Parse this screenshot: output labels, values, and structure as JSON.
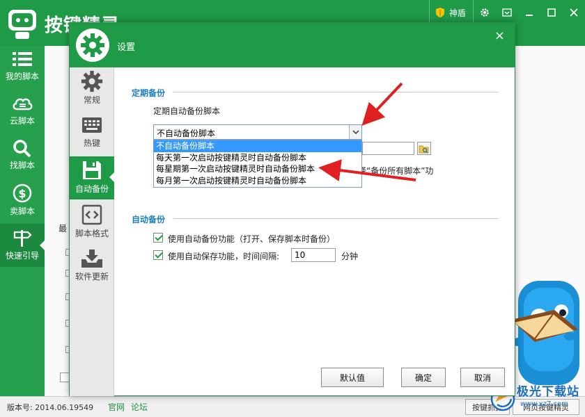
{
  "app": {
    "title": "按键精灵",
    "shield_label": "神盾",
    "sidebar": [
      {
        "label": "我的脚本",
        "icon": "list-icon"
      },
      {
        "label": "云脚本",
        "icon": "cloud-icon"
      },
      {
        "label": "找脚本",
        "icon": "search-icon"
      },
      {
        "label": "卖脚本",
        "icon": "dollar-icon"
      },
      {
        "label": "快速引导",
        "icon": "signpost-icon"
      }
    ],
    "partial_label": "最"
  },
  "status": {
    "version": "版本号: 2014.06.19549",
    "official": "官网",
    "forum": "论坛",
    "btn1": "按键抓抓",
    "btn2": "网页按键精灵"
  },
  "watermark": {
    "line1": "极光下载站",
    "line2": "www.xz7.com"
  },
  "dialog": {
    "title": "设置",
    "close": "×",
    "nav": [
      {
        "label": "常规",
        "icon": "gear-icon"
      },
      {
        "label": "热键",
        "icon": "keyboard-icon"
      },
      {
        "label": "自动备份",
        "icon": "floppy-icon"
      },
      {
        "label": "脚本格式",
        "icon": "code-icon"
      },
      {
        "label": "软件更新",
        "icon": "download-tray-icon"
      }
    ],
    "periodic_section": "定期备份",
    "periodic_label": "定期自动备份脚本",
    "select_value": "不自动备份脚本",
    "options": [
      "不自动备份脚本",
      "每天第一次启动按键精灵时自动备份脚本",
      "每星期第一次启动按键精灵时自动备份脚本",
      "每月第一次启动按键精灵时自动备份脚本"
    ],
    "hint": "择“备份所有脚本”功",
    "auto_section": "自动备份",
    "auto_backup_label": "使用自动备份功能（打开、保存脚本时备份）",
    "auto_save_label": "使用自动保存功能，时间间隔:",
    "interval_value": "10",
    "interval_unit": "分钟",
    "buttons": {
      "default": "默认值",
      "ok": "确定",
      "cancel": "取消"
    }
  },
  "colors": {
    "brand_green": "#1f9a47",
    "section_blue": "#1c7fc0",
    "arrow_red": "#e02020"
  }
}
